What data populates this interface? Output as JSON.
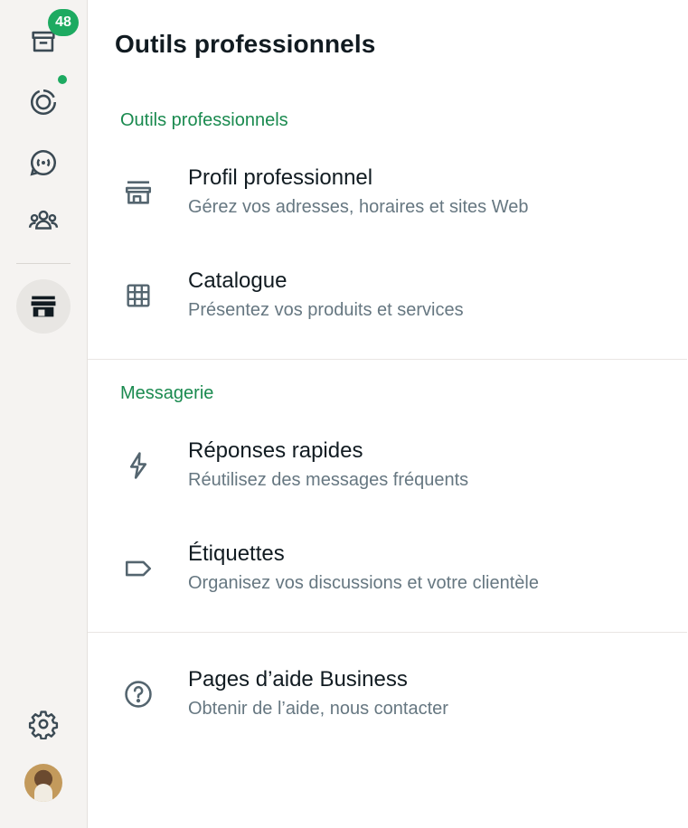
{
  "rail": {
    "chats_badge": "48",
    "items": [
      {
        "name": "chats",
        "icon": "chats-icon"
      },
      {
        "name": "status",
        "icon": "status-icon"
      },
      {
        "name": "channels",
        "icon": "channels-icon"
      },
      {
        "name": "communities",
        "icon": "communities-icon"
      },
      {
        "name": "business-tools",
        "icon": "storefront-icon",
        "active": true
      },
      {
        "name": "settings",
        "icon": "gear-icon"
      },
      {
        "name": "profile",
        "icon": "avatar"
      }
    ]
  },
  "main": {
    "title": "Outils professionnels",
    "sections": [
      {
        "title": "Outils professionnels",
        "items": [
          {
            "label": "Profil professionnel",
            "desc": "Gérez vos adresses, horaires et sites Web",
            "icon": "storefront-icon"
          },
          {
            "label": "Catalogue",
            "desc": "Présentez vos produits et services",
            "icon": "grid-icon"
          }
        ]
      },
      {
        "title": "Messagerie",
        "items": [
          {
            "label": "Réponses rapides",
            "desc": "Réutilisez des messages fréquents",
            "icon": "lightning-icon"
          },
          {
            "label": "Étiquettes",
            "desc": "Organisez vos discussions et votre clientèle",
            "icon": "label-tag-icon"
          }
        ]
      },
      {
        "title": "",
        "items": [
          {
            "label": "Pages d’aide Business",
            "desc": "Obtenir de l’aide, nous contacter",
            "icon": "help-circle-icon"
          }
        ]
      }
    ]
  },
  "colors": {
    "accent": "#1daa61",
    "section_title": "#1a8a4f",
    "rail_bg": "#f5f3f1",
    "icon": "#54656f",
    "secondary_text": "#667781"
  }
}
